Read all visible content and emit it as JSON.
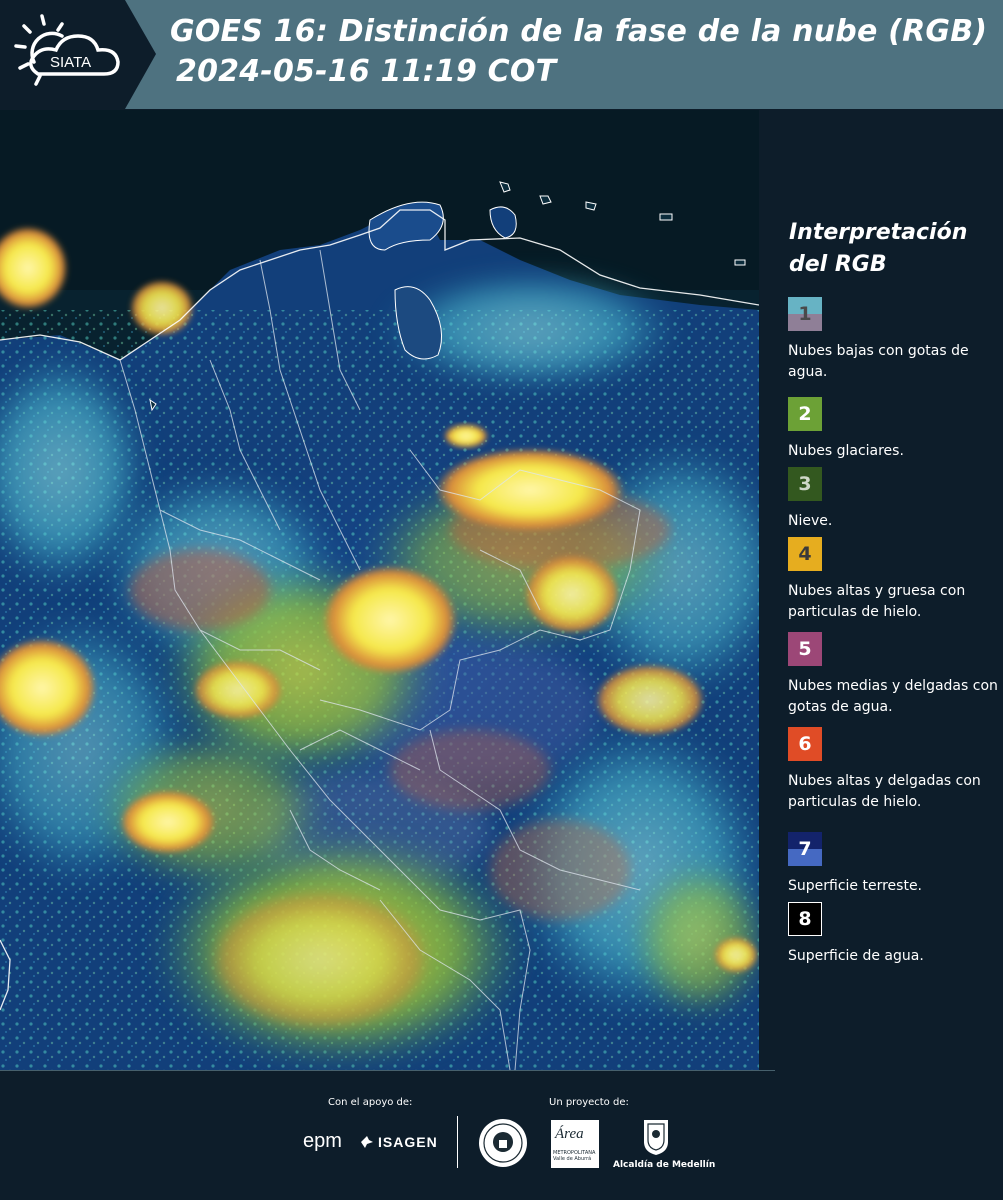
{
  "header": {
    "logo_text": "SIATA",
    "title_line1": "GOES 16: Distinción de la fase de la nube (RGB)",
    "title_line2": "2024-05-16 11:19 COT"
  },
  "map": {
    "name": "GOES-16 cloud phase RGB composite",
    "icon": "satellite-map"
  },
  "legend": {
    "title": "Interpretación del RGB",
    "items": [
      {
        "number": "1",
        "label": "Nubes bajas con gotas de agua.",
        "color_top": "#67b3c4",
        "color_bottom": "#8f7f97"
      },
      {
        "number": "2",
        "label": "Nubes glaciares.",
        "color_top": "#6ca136",
        "color_bottom": "#6ca136"
      },
      {
        "number": "3",
        "label": "Nieve.",
        "color_top": "#33581f",
        "color_bottom": "#33581f"
      },
      {
        "number": "4",
        "label": "Nubes altas y gruesa con particulas de hielo.",
        "color_top": "#e6ad1f",
        "color_bottom": "#e6ad1f"
      },
      {
        "number": "5",
        "label": "Nubes medias y delgadas con gotas de agua.",
        "color_top": "#9c4777",
        "color_bottom": "#9c4777"
      },
      {
        "number": "6",
        "label": "Nubes altas y delgadas con particulas de hielo.",
        "color_top": "#e04c26",
        "color_bottom": "#e04c26"
      },
      {
        "number": "7",
        "label": "Superficie terreste.",
        "color_top": "#13236b",
        "color_bottom": "#4569c2"
      },
      {
        "number": "8",
        "label": "Superficie de agua.",
        "color_top": "#000000",
        "color_bottom": "#000000"
      }
    ]
  },
  "footer": {
    "support_label": "Con el apoyo de:",
    "project_label": "Un proyecto de:",
    "epm": "epm",
    "isagen": "ISAGEN",
    "area_title": "Área",
    "area_sub": "METROPOLITANA Valle de Aburrá",
    "medellin": "Alcaldía de Medellín"
  },
  "colors": {
    "header_bg": "#4e7280",
    "panel_bg": "#0d1d2a"
  }
}
